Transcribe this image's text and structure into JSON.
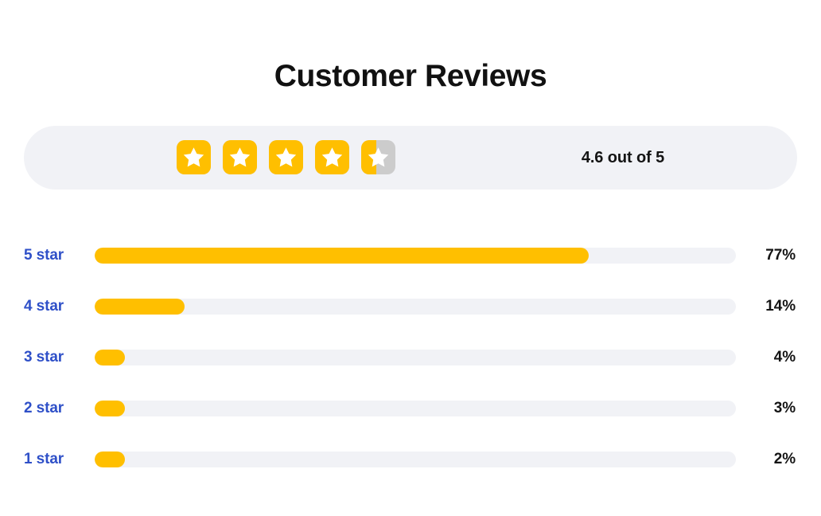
{
  "page": {
    "title": "Customer Reviews",
    "background_color": "#FFFFFF"
  },
  "colors": {
    "star_filled": "#FFBF00",
    "star_empty": "#CCCCCC",
    "track": "#F1F2F6",
    "card_background": "#F1F2F6",
    "label_blue": "#2F50C8",
    "text_dark": "#141414"
  },
  "summary": {
    "rating_text": "4.6 out of 5",
    "rating_value": 4.6,
    "rating_max": 5,
    "stars": [
      {
        "name": "star-1",
        "fill_ratio": 1
      },
      {
        "name": "star-2",
        "fill_ratio": 1
      },
      {
        "name": "star-3",
        "fill_ratio": 1
      },
      {
        "name": "star-4",
        "fill_ratio": 1
      },
      {
        "name": "star-5",
        "fill_ratio": 0.45
      }
    ]
  },
  "chart_data": {
    "type": "bar",
    "title": "Customer Reviews",
    "xlabel": "",
    "ylabel": "",
    "orientation": "horizontal",
    "grid": false,
    "legend": false,
    "xlim": [
      0,
      100
    ],
    "categories": [
      "5 star",
      "4 star",
      "3 star",
      "2 star",
      "1 star"
    ],
    "values": [
      77,
      14,
      4,
      3,
      2
    ],
    "value_labels": [
      "77%",
      "14%",
      "4%",
      "3%",
      "2%"
    ],
    "bar_widths_pct": [
      77,
      14,
      4.7,
      4.7,
      4.7
    ]
  },
  "breakdown": {
    "rows": [
      {
        "label": "5 star",
        "percent_label": "77%",
        "value": 77,
        "bar_width_pct": 77
      },
      {
        "label": "4 star",
        "percent_label": "14%",
        "value": 14,
        "bar_width_pct": 14
      },
      {
        "label": "3 star",
        "percent_label": "4%",
        "value": 4,
        "bar_width_pct": 4.7
      },
      {
        "label": "2 star",
        "percent_label": "3%",
        "value": 3,
        "bar_width_pct": 4.7
      },
      {
        "label": "1 star",
        "percent_label": "2%",
        "value": 2,
        "bar_width_pct": 4.7
      }
    ]
  }
}
